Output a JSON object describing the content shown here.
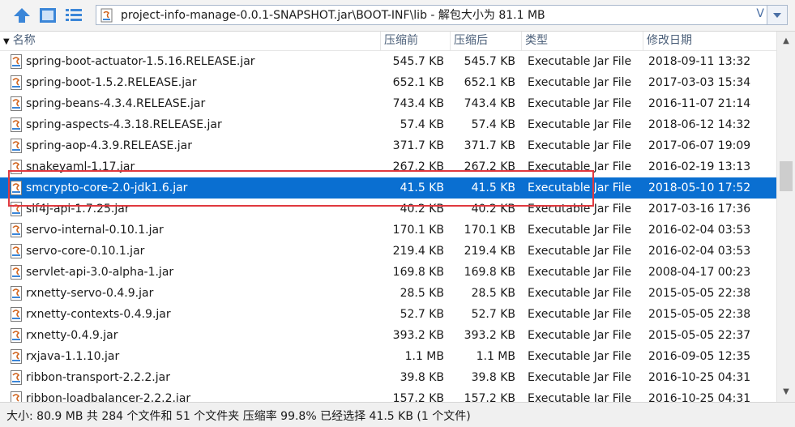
{
  "toolbar": {
    "icons": [
      "up-arrow-icon",
      "grid-view-icon",
      "list-view-icon"
    ],
    "path": "project-info-manage-0.0.1-SNAPSHOT.jar\\BOOT-INF\\lib - 解包大小为 81.1 MB",
    "path_dropdown": "V"
  },
  "columns": {
    "name": "名称",
    "compressed": "压缩前",
    "original": "压缩后",
    "type": "类型",
    "modified": "修改日期"
  },
  "files": [
    {
      "name": "spring-boot-actuator-1.5.16.RELEASE.jar",
      "compressed": "545.7 KB",
      "original": "545.7 KB",
      "type": "Executable Jar File",
      "modified": "2018-09-11 13:32"
    },
    {
      "name": "spring-boot-1.5.2.RELEASE.jar",
      "compressed": "652.1 KB",
      "original": "652.1 KB",
      "type": "Executable Jar File",
      "modified": "2017-03-03 15:34"
    },
    {
      "name": "spring-beans-4.3.4.RELEASE.jar",
      "compressed": "743.4 KB",
      "original": "743.4 KB",
      "type": "Executable Jar File",
      "modified": "2016-11-07 21:14"
    },
    {
      "name": "spring-aspects-4.3.18.RELEASE.jar",
      "compressed": "57.4 KB",
      "original": "57.4 KB",
      "type": "Executable Jar File",
      "modified": "2018-06-12 14:32"
    },
    {
      "name": "spring-aop-4.3.9.RELEASE.jar",
      "compressed": "371.7 KB",
      "original": "371.7 KB",
      "type": "Executable Jar File",
      "modified": "2017-06-07 19:09"
    },
    {
      "name": "snakeyaml-1.17.jar",
      "compressed": "267.2 KB",
      "original": "267.2 KB",
      "type": "Executable Jar File",
      "modified": "2016-02-19 13:13"
    },
    {
      "name": "smcrypto-core-2.0-jdk1.6.jar",
      "compressed": "41.5 KB",
      "original": "41.5 KB",
      "type": "Executable Jar File",
      "modified": "2018-05-10 17:52",
      "selected": true
    },
    {
      "name": "slf4j-api-1.7.25.jar",
      "compressed": "40.2 KB",
      "original": "40.2 KB",
      "type": "Executable Jar File",
      "modified": "2017-03-16 17:36"
    },
    {
      "name": "servo-internal-0.10.1.jar",
      "compressed": "170.1 KB",
      "original": "170.1 KB",
      "type": "Executable Jar File",
      "modified": "2016-02-04 03:53"
    },
    {
      "name": "servo-core-0.10.1.jar",
      "compressed": "219.4 KB",
      "original": "219.4 KB",
      "type": "Executable Jar File",
      "modified": "2016-02-04 03:53"
    },
    {
      "name": "servlet-api-3.0-alpha-1.jar",
      "compressed": "169.8 KB",
      "original": "169.8 KB",
      "type": "Executable Jar File",
      "modified": "2008-04-17 00:23"
    },
    {
      "name": "rxnetty-servo-0.4.9.jar",
      "compressed": "28.5 KB",
      "original": "28.5 KB",
      "type": "Executable Jar File",
      "modified": "2015-05-05 22:38"
    },
    {
      "name": "rxnetty-contexts-0.4.9.jar",
      "compressed": "52.7 KB",
      "original": "52.7 KB",
      "type": "Executable Jar File",
      "modified": "2015-05-05 22:38"
    },
    {
      "name": "rxnetty-0.4.9.jar",
      "compressed": "393.2 KB",
      "original": "393.2 KB",
      "type": "Executable Jar File",
      "modified": "2015-05-05 22:37"
    },
    {
      "name": "rxjava-1.1.10.jar",
      "compressed": "1.1 MB",
      "original": "1.1 MB",
      "type": "Executable Jar File",
      "modified": "2016-09-05 12:35"
    },
    {
      "name": "ribbon-transport-2.2.2.jar",
      "compressed": "39.8 KB",
      "original": "39.8 KB",
      "type": "Executable Jar File",
      "modified": "2016-10-25 04:31"
    },
    {
      "name": "ribbon-loadbalancer-2.2.2.jar",
      "compressed": "157.2 KB",
      "original": "157.2 KB",
      "type": "Executable Jar File",
      "modified": "2016-10-25 04:31"
    }
  ],
  "status": "大小: 80.9 MB 共 284 个文件和 51 个文件夹 压缩率 99.8% 已经选择 41.5 KB (1 个文件)",
  "colors": {
    "selection": "#0a6fd1",
    "highlight_box": "#e0393f",
    "header_text": "#4c607a"
  }
}
